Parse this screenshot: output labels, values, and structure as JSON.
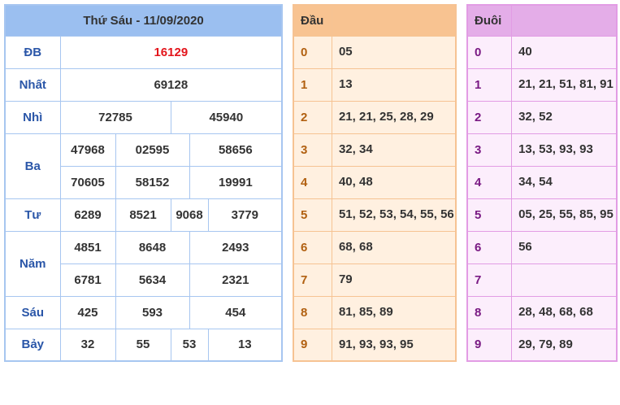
{
  "results": {
    "title": "Thứ Sáu - 11/09/2020",
    "labels": {
      "db": "ĐB",
      "nhat": "Nhất",
      "nhi": "Nhì",
      "ba": "Ba",
      "tu": "Tư",
      "nam": "Năm",
      "sau": "Sáu",
      "bay": "Bảy"
    },
    "db": "16129",
    "nhat": "69128",
    "nhi": [
      "72785",
      "45940"
    ],
    "ba": [
      "47968",
      "02595",
      "58656",
      "70605",
      "58152",
      "19991"
    ],
    "tu": [
      "6289",
      "8521",
      "9068",
      "3779"
    ],
    "nam": [
      "4851",
      "8648",
      "2493",
      "6781",
      "5634",
      "2321"
    ],
    "sau": [
      "425",
      "593",
      "454"
    ],
    "bay": [
      "32",
      "55",
      "53",
      "13"
    ]
  },
  "dau": {
    "header": "Đầu",
    "rows": [
      {
        "key": "0",
        "value": "05"
      },
      {
        "key": "1",
        "value": "13"
      },
      {
        "key": "2",
        "value": "21, 21, 25, 28, 29"
      },
      {
        "key": "3",
        "value": "32, 34"
      },
      {
        "key": "4",
        "value": "40, 48"
      },
      {
        "key": "5",
        "value": "51, 52, 53, 54, 55, 56"
      },
      {
        "key": "6",
        "value": "68, 68"
      },
      {
        "key": "7",
        "value": "79"
      },
      {
        "key": "8",
        "value": "81, 85, 89"
      },
      {
        "key": "9",
        "value": "91, 93, 93, 95"
      }
    ]
  },
  "duoi": {
    "header": "Đuôi",
    "rows": [
      {
        "key": "0",
        "value": "40"
      },
      {
        "key": "1",
        "value": "21, 21, 51, 81, 91"
      },
      {
        "key": "2",
        "value": "32, 52"
      },
      {
        "key": "3",
        "value": "13, 53, 93, 93"
      },
      {
        "key": "4",
        "value": "34, 54"
      },
      {
        "key": "5",
        "value": "05, 25, 55, 85, 95"
      },
      {
        "key": "6",
        "value": "56"
      },
      {
        "key": "7",
        "value": ""
      },
      {
        "key": "8",
        "value": "28, 48, 68, 68"
      },
      {
        "key": "9",
        "value": "29, 79, 89"
      }
    ]
  },
  "colors": {
    "main_border": "#a7c6f0",
    "main_header": "#9bbff0",
    "label_text": "#2a56a8",
    "special_prize": "#e3151b",
    "dau_border": "#f6c393",
    "dau_header": "#f8c391",
    "dau_bg": "#fff0e0",
    "dau_key": "#b16011",
    "duoi_border": "#e29ce4",
    "duoi_header": "#e4ade8",
    "duoi_bg": "#fceefc",
    "duoi_key": "#7a1a84"
  }
}
